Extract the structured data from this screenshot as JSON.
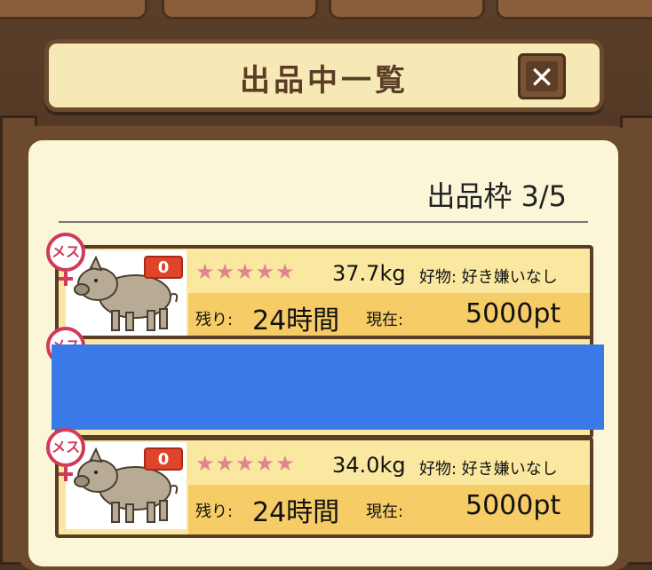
{
  "tabs": [
    "",
    "",
    "",
    ""
  ],
  "header": {
    "title": "出品中一覧",
    "close_label": "✕"
  },
  "slots": {
    "label": "出品枠 3/5"
  },
  "listings": [
    {
      "sex_label": "メス",
      "count": "0",
      "stars": "★★★★★",
      "weight": "37.7kg",
      "likes": "好物: 好き嫌いなし",
      "remaining_label": "残り:",
      "remaining_value": "24時間",
      "current_label": "現在:",
      "current_value": "5000pt"
    },
    {
      "sex_label": "メス"
    },
    {
      "sex_label": "メス",
      "count": "0",
      "stars": "★★★★★",
      "weight": "34.0kg",
      "likes": "好物: 好き嫌いなし",
      "remaining_label": "残り:",
      "remaining_value": "24時間",
      "current_label": "現在:",
      "current_value": "5000pt"
    }
  ],
  "colors": {
    "accent": "#3a7ae8",
    "panel": "#fbf6d8",
    "wood": "#6b4a2e",
    "star": "#e0858f"
  }
}
